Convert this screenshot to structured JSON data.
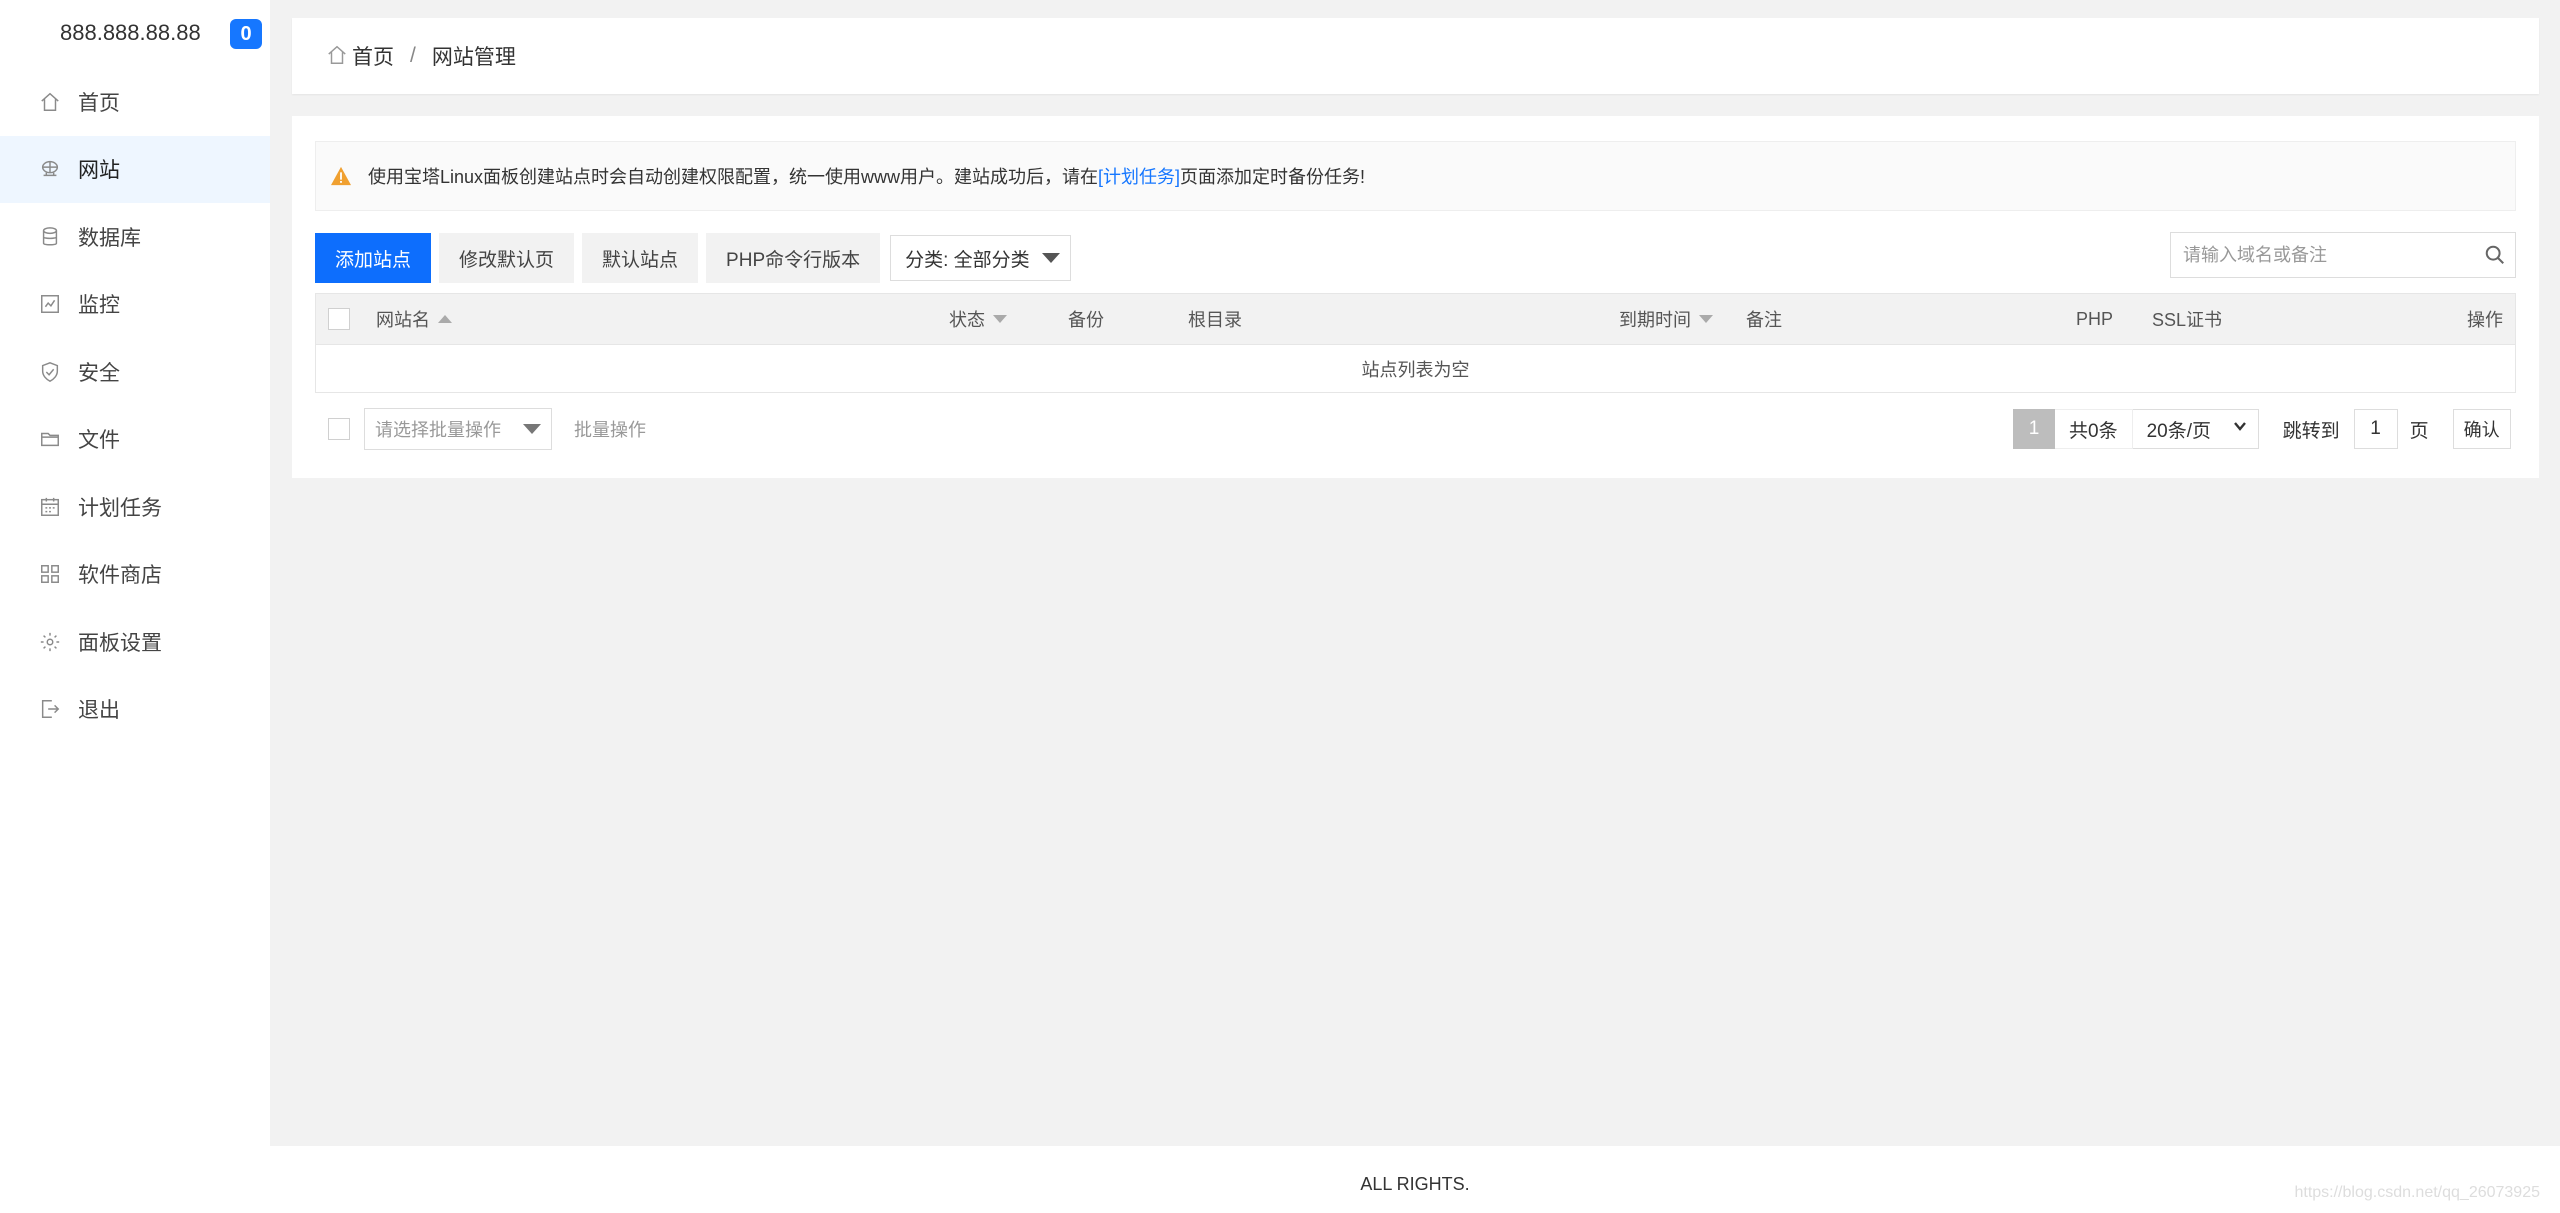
{
  "sidebar": {
    "server_ip": "888.888.88.88",
    "badge_count": "0",
    "items": [
      {
        "label": "首页",
        "icon": "home-icon"
      },
      {
        "label": "网站",
        "icon": "globe-icon"
      },
      {
        "label": "数据库",
        "icon": "database-icon"
      },
      {
        "label": "监控",
        "icon": "monitor-icon"
      },
      {
        "label": "安全",
        "icon": "shield-icon"
      },
      {
        "label": "文件",
        "icon": "folder-icon"
      },
      {
        "label": "计划任务",
        "icon": "calendar-icon"
      },
      {
        "label": "软件商店",
        "icon": "grid-icon"
      },
      {
        "label": "面板设置",
        "icon": "gear-icon"
      },
      {
        "label": "退出",
        "icon": "logout-icon"
      }
    ],
    "active_index": 1
  },
  "breadcrumb": {
    "home": "首页",
    "separator": "/",
    "current": "网站管理"
  },
  "notice": {
    "text_before": "使用宝塔Linux面板创建站点时会自动创建权限配置，统一使用www用户。建站成功后，请在",
    "link": "[计划任务]",
    "text_after": "页面添加定时备份任务!"
  },
  "toolbar": {
    "add_site": "添加站点",
    "modify_default_page": "修改默认页",
    "default_site": "默认站点",
    "php_cli_version": "PHP命令行版本",
    "category": "分类: 全部分类"
  },
  "search": {
    "placeholder": "请输入域名或备注"
  },
  "table": {
    "columns": [
      "网站名",
      "状态",
      "备份",
      "根目录",
      "到期时间",
      "备注",
      "PHP",
      "SSL证书",
      "操作"
    ],
    "empty_text": "站点列表为空"
  },
  "batch": {
    "placeholder": "请选择批量操作",
    "action": "批量操作"
  },
  "pager": {
    "current_page": "1",
    "total": "共0条",
    "page_size": "20条/页",
    "jump_label": "跳转到",
    "jump_value": "1",
    "page_unit": "页",
    "confirm": "确认"
  },
  "footer": {
    "text": "ALL RIGHTS."
  },
  "watermark": "https://blog.csdn.net/qq_26073925",
  "colors": {
    "primary": "#0d6efd",
    "badge": "#1677ff",
    "link": "#1677ff",
    "active_bg": "#eef6ff",
    "warning": "#f0a030"
  }
}
